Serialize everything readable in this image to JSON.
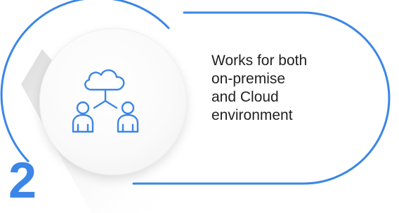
{
  "step": {
    "number": "2"
  },
  "feature": {
    "text": "Works for both\non-premise\nand Cloud\nenvironment",
    "icon": "cloud-users-network-icon"
  },
  "colors": {
    "accent": "#3b86e6",
    "text": "#222222",
    "circle": "#fafafa"
  }
}
